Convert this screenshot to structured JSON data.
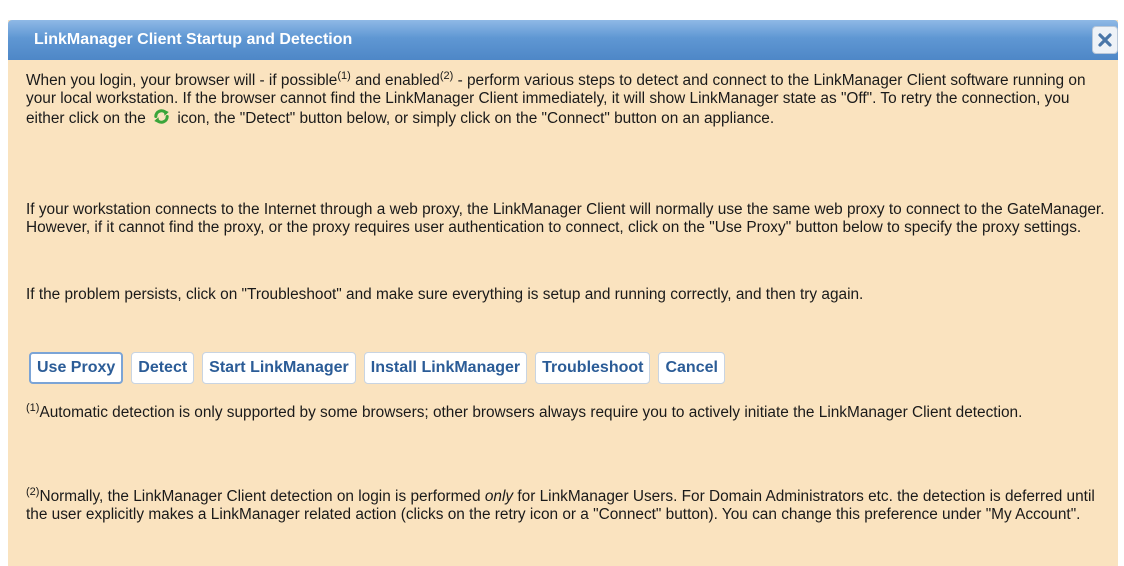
{
  "dialog": {
    "title": "LinkManager Client Startup and Detection",
    "close_icon": "close-icon"
  },
  "paragraph1": {
    "part1": "When you login, your browser will - if possible",
    "sup1": "(1)",
    "part2": " and enabled",
    "sup2": "(2)",
    "part3": " - perform various steps to detect and connect to the LinkManager Client software running on your local workstation. If the browser cannot find the LinkManager Client immediately, it will show LinkManager state as \"Off\". To retry the connection, you either click on the ",
    "icon": "refresh-icon",
    "part4": " icon, the \"Detect\" button below, or simply click on the \"Connect\" button on an appliance."
  },
  "paragraph2": "If your workstation connects to the Internet through a web proxy, the LinkManager Client will normally use the same web proxy to connect to the GateManager. However, if it cannot find the proxy, or the proxy requires user authentication to connect, click on the \"Use Proxy\" button below to specify the proxy settings.",
  "paragraph3": "If the problem persists, click on \"Troubleshoot\" and make sure everything is setup and running correctly, and then try again.",
  "buttons": {
    "use_proxy": "Use Proxy",
    "detect": "Detect",
    "start_linkmanager": "Start LinkManager",
    "install_linkmanager": "Install LinkManager",
    "troubleshoot": "Troubleshoot",
    "cancel": "Cancel"
  },
  "footnote1": {
    "marker": "(1)",
    "text": "Automatic detection is only supported by some browsers; other browsers always require you to actively initiate the LinkManager Client detection."
  },
  "footnote2": {
    "marker": "(2)",
    "text_before": "Normally, the LinkManager Client detection on login is performed ",
    "emphasis": "only",
    "text_after": " for LinkManager Users. For Domain Administrators etc. the detection is deferred until the user explicitly makes a LinkManager related action (clicks on the retry icon or a \"Connect\" button). You can change this preference under \"My Account\"."
  },
  "colors": {
    "title_bar": "#5f97d3",
    "dialog_background": "#fae3bf",
    "button_text": "#2b5c97",
    "refresh_icon": "#3aa53a"
  }
}
